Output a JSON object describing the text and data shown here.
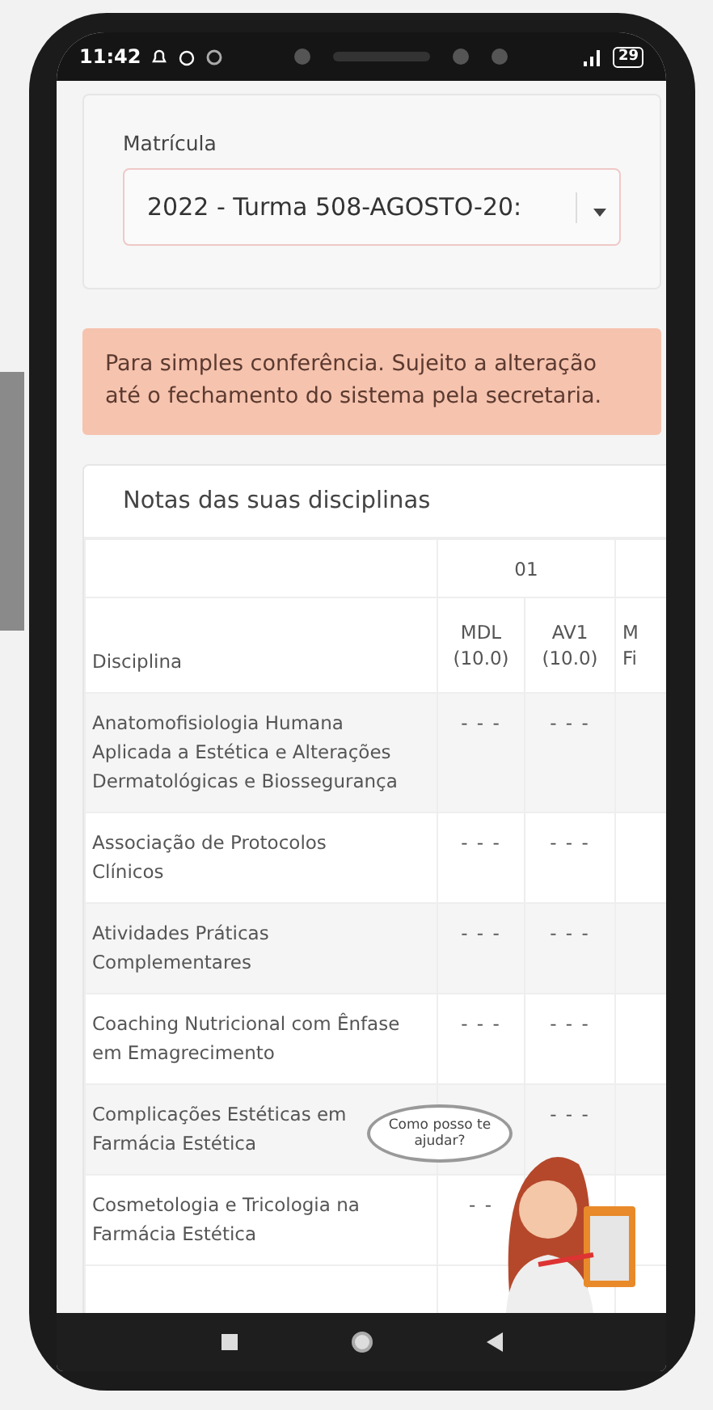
{
  "status_bar": {
    "time": "11:42",
    "battery": "29"
  },
  "enrollment": {
    "label": "Matrícula",
    "value": "2022 - Turma 508-AGOSTO-20:"
  },
  "notice": "Para simples conferência. Sujeito a alteração até o fechamento do sistema pela secretaria.",
  "grades": {
    "title": "Notas das suas disciplinas",
    "group_header": "01",
    "subject_header": "Disciplina",
    "columns": [
      [
        "MDL",
        "(10.0)"
      ],
      [
        "AV1",
        "(10.0)"
      ],
      [
        "M",
        "Fi"
      ]
    ],
    "rows": [
      {
        "subject": "Anatomofisiologia Humana Aplicada a Estética e Alterações Dermatológicas e Biossegurança",
        "values": {
          "mdl": "- - -",
          "av1": "- - -"
        }
      },
      {
        "subject": "Associação de Protocolos Clínicos",
        "values": {
          "mdl": "- - -",
          "av1": "- - -"
        }
      },
      {
        "subject": "Atividades Práticas Complementares",
        "values": {
          "mdl": "- - -",
          "av1": "- - -"
        }
      },
      {
        "subject": "Coaching Nutricional com Ênfase em Emagrecimento",
        "values": {
          "mdl": "- - -",
          "av1": "- - -"
        }
      },
      {
        "subject": "Complicações Estéticas em Farmácia Estética",
        "values": {
          "av1": "- - -"
        }
      },
      {
        "subject": "Cosmetologia e Tricologia na Farmácia Estética",
        "values": {
          "mdl": "- -"
        }
      }
    ]
  },
  "assistant": {
    "bubble": "Como posso te ajudar?"
  }
}
